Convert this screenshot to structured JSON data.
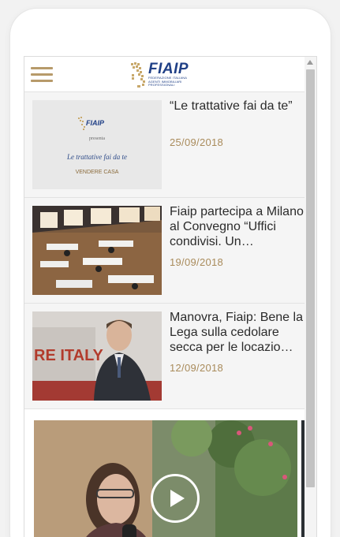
{
  "brand": {
    "logo_word": "FIAIP",
    "logo_subtitle": "FEDERAZIONE ITALIANA\nAGENTI IMMOBILIARI\nPROFESSIONALI",
    "accent_gold": "#b79a6a",
    "brand_blue": "#1f3f86"
  },
  "header": {
    "menu_icon": "hamburger-menu-icon"
  },
  "articles": [
    {
      "title": "“Le trattative fai da te”",
      "date": "25/09/2018",
      "thumb": {
        "presents": "presenta",
        "headline": "Le trattative fai da te",
        "subhead": "VENDERE CASA"
      }
    },
    {
      "title": "Fiaip partecipa a Milano al Convegno “Uffici condivisi. Un…",
      "date": "19/09/2018"
    },
    {
      "title": "Manovra, Fiaip: Bene la Lega sulla cedolare secca per le locazio…",
      "date": "12/09/2018",
      "thumb": {
        "backdrop_text": "RE ITALY"
      }
    }
  ],
  "video": {
    "play_icon": "play-icon"
  }
}
